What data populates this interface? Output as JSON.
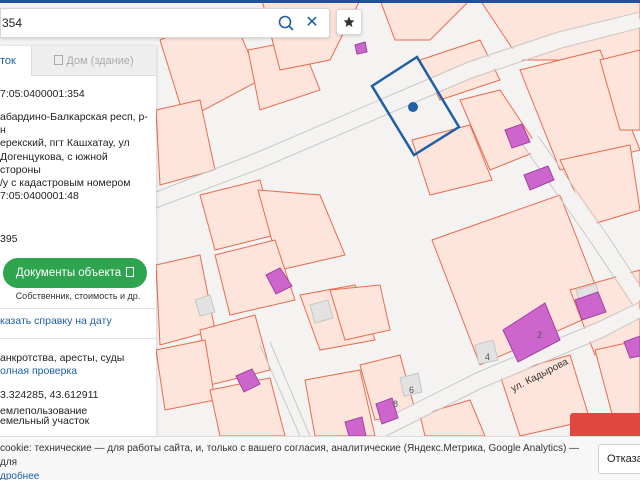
{
  "search": {
    "value": "354"
  },
  "panel": {
    "tab_active": "ток",
    "tab_inactive": "Дом (здание)",
    "cadastral_number": "7:05:0400001:354",
    "address_lines": [
      "абардино-Балкарская респ, р-н",
      "ерекский, пгт Кашхатау, ул",
      "Догенцукова, с южной стороны",
      "/у с кадастровым номером",
      "7:05:0400001:48"
    ],
    "area": "395",
    "docs_button": "Документы объекта",
    "docs_sub": "Собственник, стоимость и др.",
    "certificate_link": "казать справку на дату",
    "bankruptcy": "анкротства, аресты, суды",
    "full_check_link": "олная проверка",
    "coordinates": "3.324285, 43.612911",
    "land_type": "емельный участок",
    "land_use": "емлепользование"
  },
  "map": {
    "street": "ул. Кадырова",
    "house_numbers": [
      "2",
      "4",
      "6",
      "8"
    ],
    "colors": {
      "parcel_fill": "#fde5dc",
      "parcel_border": "#e96b4f",
      "building": "#cc66cc",
      "selected": "#1f5fa8",
      "road": "#f4f3f1"
    }
  },
  "cookie": {
    "text": "cookie: технические — для работы сайта, и, только с вашего согласия, аналитические (Яндекс.Метрика, Google Analytics) — для",
    "more_link": "дробнее",
    "refuse_button": "Отказа"
  },
  "icons": {
    "search": "search-icon",
    "clear": "close-icon",
    "favorite": "star-icon",
    "document": "document-icon",
    "house": "house-icon"
  }
}
